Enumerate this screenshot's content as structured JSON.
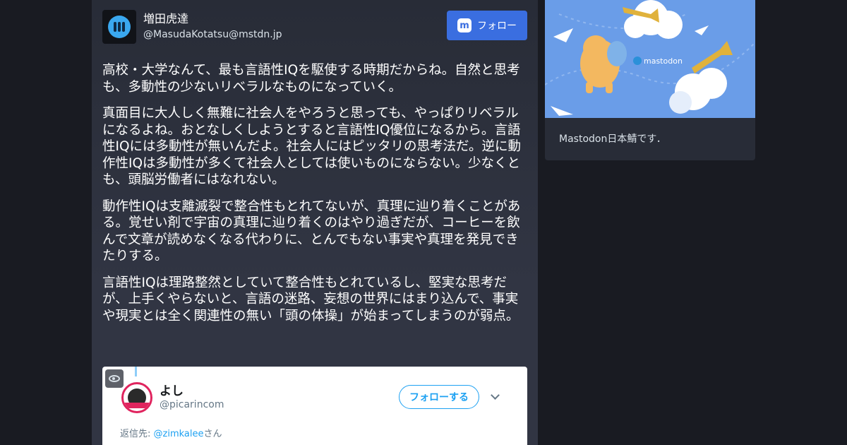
{
  "account": {
    "display_name": "増田虎達",
    "acct": "@MasudaKotatsu@mstdn.jp",
    "avatar_icon": "mastodon-avatar-icon"
  },
  "follow_button": {
    "label": "フォロー",
    "icon": "mastodon-logo-icon"
  },
  "status": {
    "paragraphs": [
      "高校・大学なんて、最も言語性IQを駆使する時期だからね。自然と思考も、多動性の少ないリベラルなものになっていく。",
      "真面目に大人しく無難に社会人をやろうと思っても、やっぱりリベラルになるよね。おとなしくしようとすると言語性IQ優位になるから。言語性IQには多動性が無いんだよ。社会人にはピッタリの思考法だ。逆に動作性IQは多動性が多くて社会人としては使いものにならない。少なくとも、頭脳労働者にはなれない。",
      "動作性IQは支離滅裂で整合性もとれてないが、真理に辿り着くことがある。覚せい剤で宇宙の真理に辿り着くのはやり過ぎだが、コーヒーを飲んで文章が読めなくなる代わりに、とんでもない事実や真理を発見できたりする。",
      "言語性IQは理路整然としていて整合性もとれているし、堅実な思考だが、上手くやらないと、言語の迷路、妄想の世界にはまり込んで、事実や現実とは全く関連性の無い「頭の体操」が始まってしまうのが弱点。"
    ]
  },
  "media": {
    "toggle_icon": "eye-icon",
    "embedded_tweet": {
      "name": "よし",
      "handle": "@picarincom",
      "follow_label": "フォローする",
      "reply_prefix": "返信先: ",
      "reply_mention": "@zimkalee",
      "reply_suffix": "さん"
    }
  },
  "instance": {
    "hero_logo_text": "mastodon",
    "description": "Mastodon日本鯖です．"
  },
  "colors": {
    "background": "#191b22",
    "card": "#313543",
    "accent": "#3a6ee0",
    "hero_blue": "#6a9de8"
  }
}
